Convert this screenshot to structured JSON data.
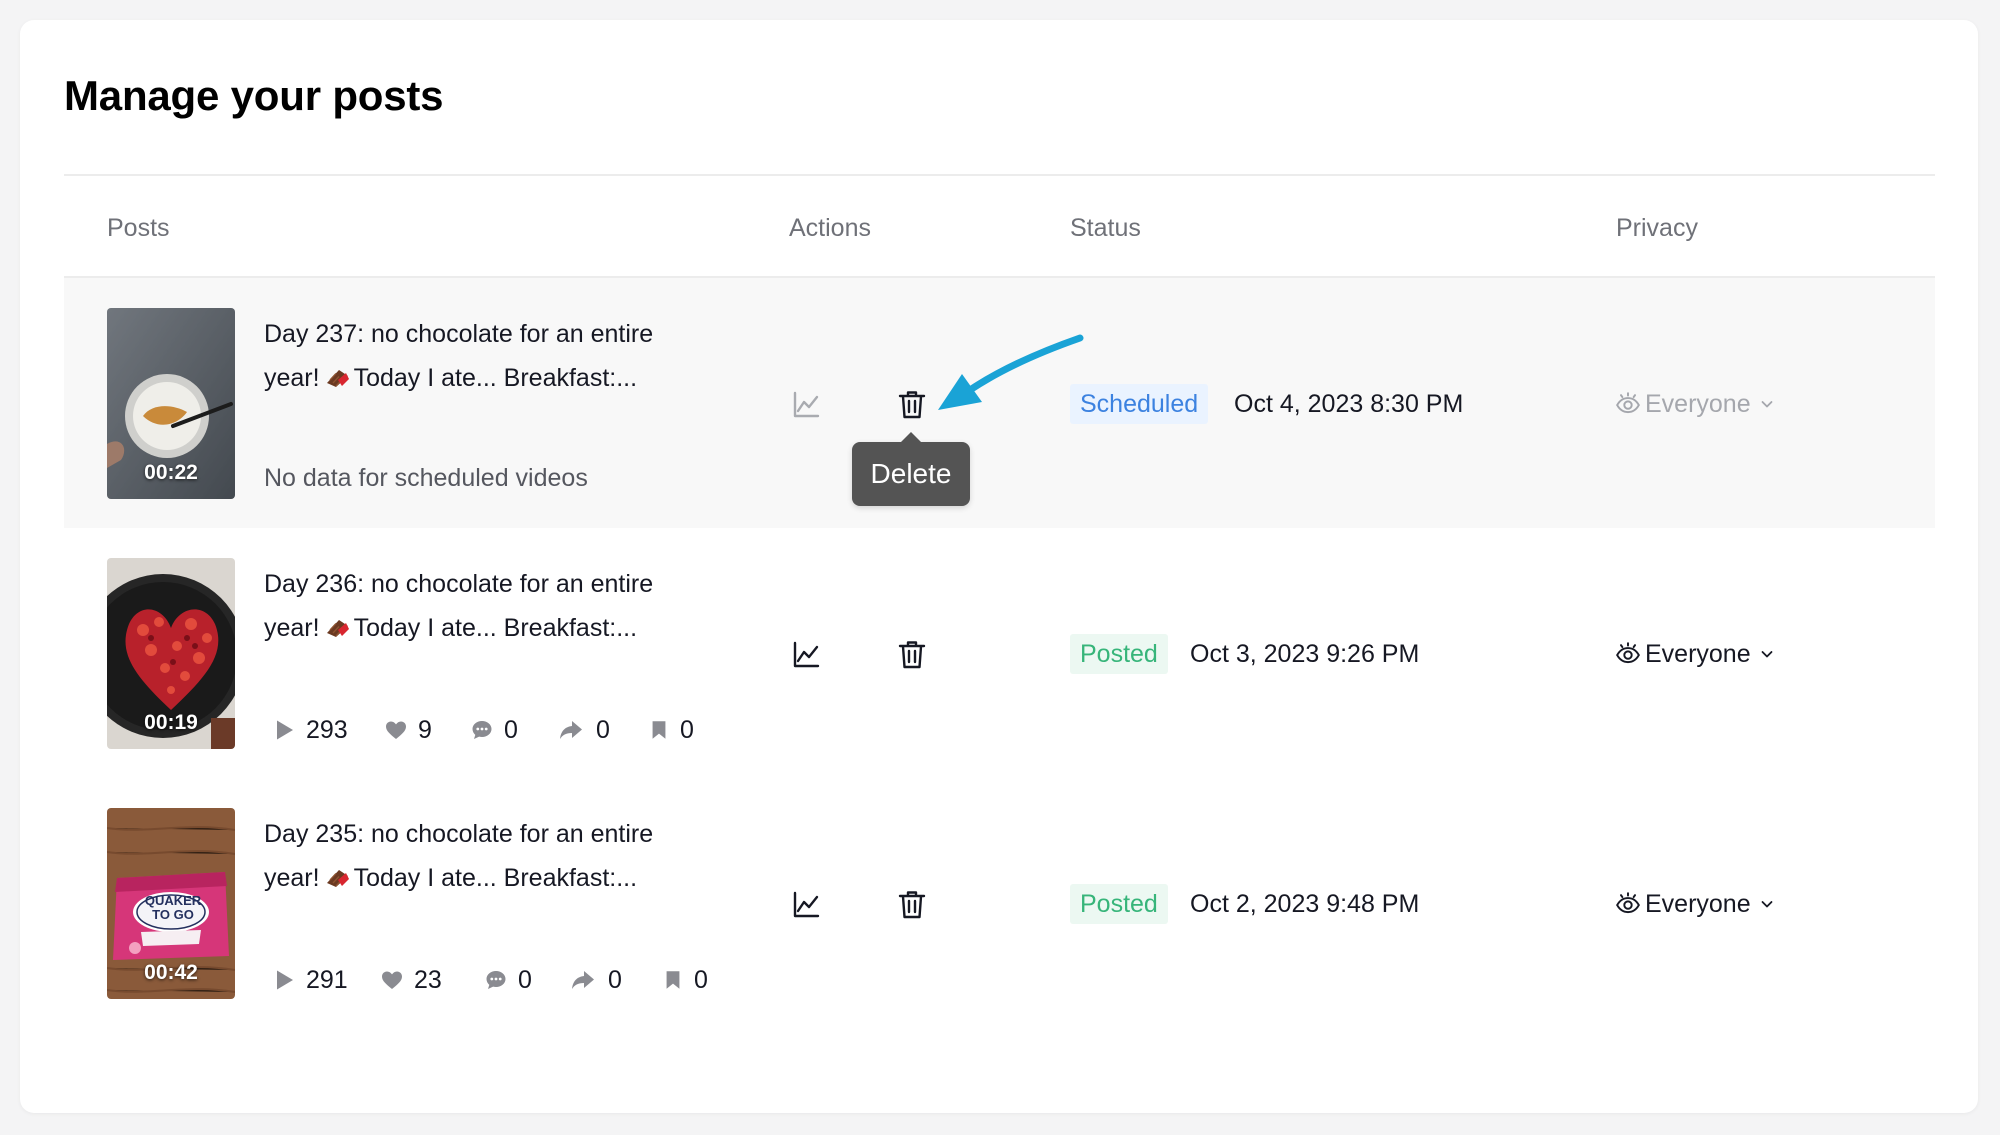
{
  "page_title": "Manage your posts",
  "columns": {
    "posts": "Posts",
    "actions": "Actions",
    "status": "Status",
    "privacy": "Privacy"
  },
  "tooltip": {
    "delete": "Delete"
  },
  "colors": {
    "scheduled_text": "#3c82e0",
    "scheduled_bg": "#eaf3ff",
    "posted_text": "#37b57a",
    "posted_bg": "#ecf8f2",
    "annotation_arrow": "#1aa3d6"
  },
  "posts": [
    {
      "duration": "00:22",
      "caption_line1": "Day 237: no chocolate for an entire",
      "caption_line2_pre": "year!",
      "caption_line2_post": "Today I ate... Breakfast:...",
      "no_data": "No data for scheduled videos",
      "status": "Scheduled",
      "date": "Oct 4, 2023 8:30 PM",
      "privacy": "Everyone"
    },
    {
      "duration": "00:19",
      "caption_line1": "Day 236: no chocolate for an entire",
      "caption_line2_pre": "year!",
      "caption_line2_post": "Today I ate... Breakfast:...",
      "stats": {
        "views": "293",
        "likes": "9",
        "comments": "0",
        "shares": "0",
        "saves": "0"
      },
      "status": "Posted",
      "date": "Oct 3, 2023 9:26 PM",
      "privacy": "Everyone"
    },
    {
      "duration": "00:42",
      "caption_line1": "Day 235: no chocolate for an entire",
      "caption_line2_pre": "year!",
      "caption_line2_post": "Today I ate... Breakfast:...",
      "stats": {
        "views": "291",
        "likes": "23",
        "comments": "0",
        "shares": "0",
        "saves": "0"
      },
      "status": "Posted",
      "date": "Oct 2, 2023 9:48 PM",
      "privacy": "Everyone"
    }
  ]
}
